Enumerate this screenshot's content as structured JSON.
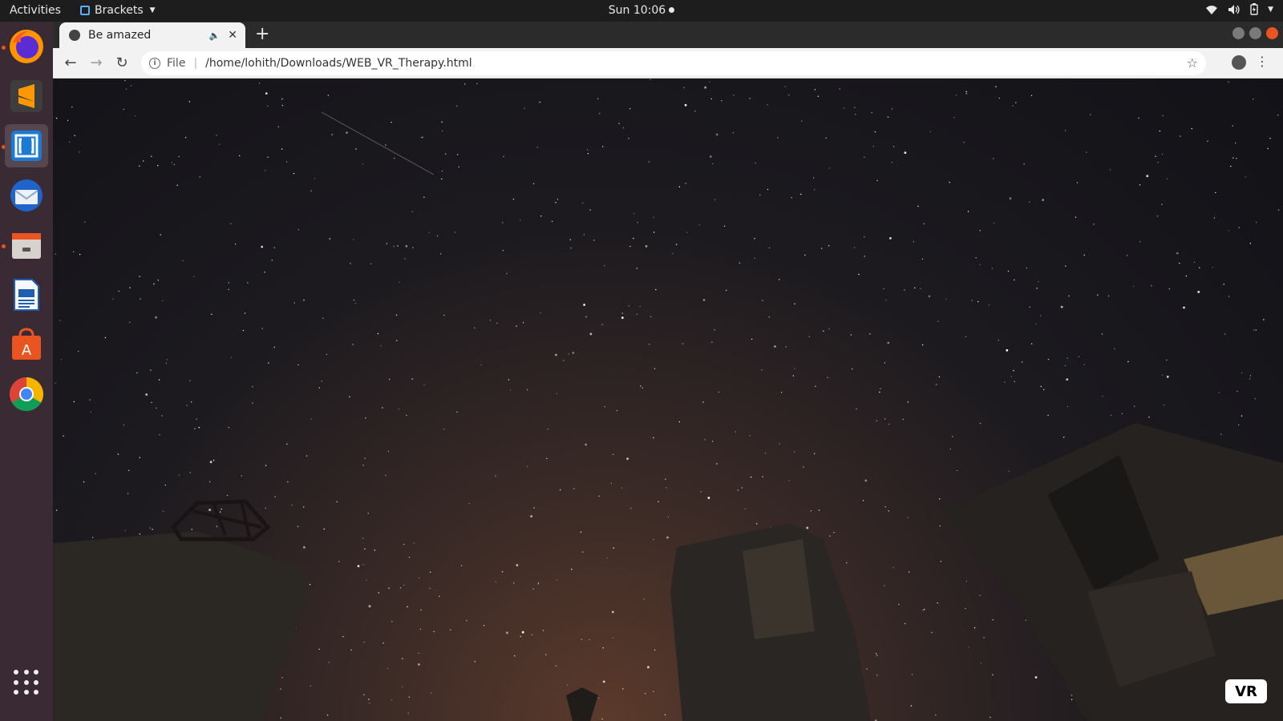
{
  "topbar": {
    "activities": "Activities",
    "app_name": "Brackets",
    "clock": "Sun 10:06"
  },
  "dock": {
    "items": [
      {
        "name": "Firefox",
        "icon": "firefox-icon",
        "running": true
      },
      {
        "name": "Sublime Text",
        "icon": "sublime-text-icon",
        "running": false
      },
      {
        "name": "Brackets",
        "icon": "brackets-icon",
        "running": true,
        "active": true
      },
      {
        "name": "Thunderbird",
        "icon": "thunderbird-icon",
        "running": false
      },
      {
        "name": "Files",
        "icon": "files-icon",
        "running": true
      },
      {
        "name": "LibreOffice Writer",
        "icon": "writer-icon",
        "running": false
      },
      {
        "name": "Ubuntu Software",
        "icon": "software-center-icon",
        "running": false
      },
      {
        "name": "Google Chrome",
        "icon": "chrome-icon",
        "running": false
      }
    ]
  },
  "browser": {
    "tab_title": "Be amazed",
    "address_scheme": "File",
    "address_url": "/home/lohith/Downloads/WEB_VR_Therapy.html"
  },
  "page": {
    "vr_button": "VR"
  },
  "colors": {
    "ubuntu_orange": "#e95420",
    "dock_bg": "#3a2a33",
    "topbar_bg": "#1d1d1d"
  }
}
